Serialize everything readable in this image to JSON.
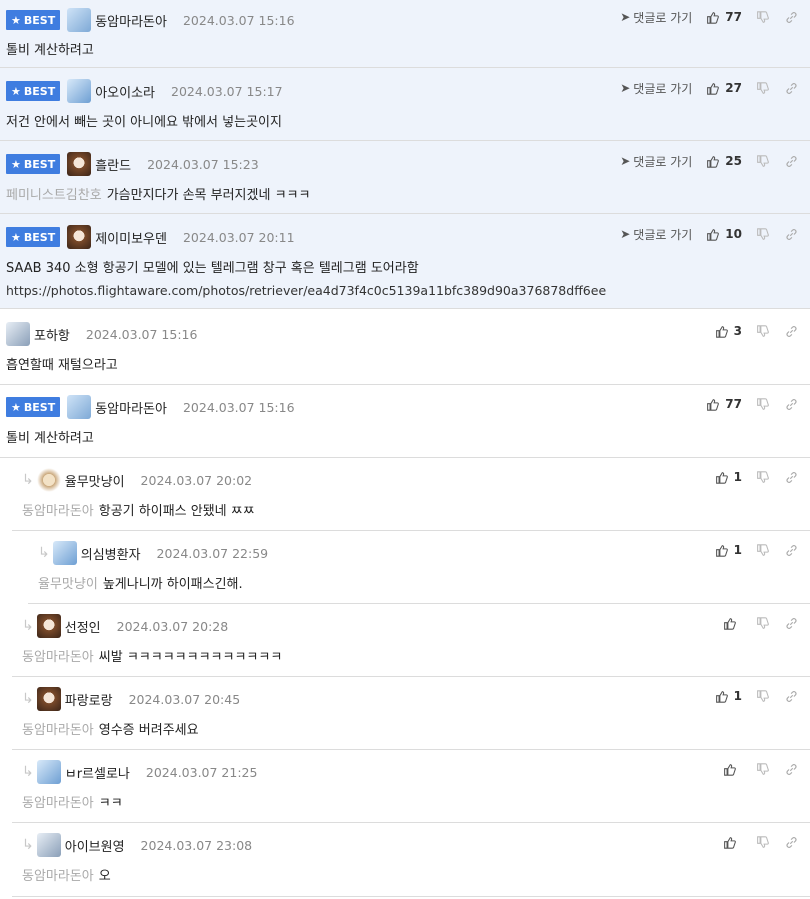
{
  "best_label": "BEST",
  "goto_label": "댓글로 가기",
  "comments": [
    {
      "nick": "동암마라돈아",
      "date": "2024.03.07 15:16",
      "text": "톨비 계산하려고",
      "likes": "77",
      "best": true,
      "goto": true,
      "avatar": "blue"
    },
    {
      "nick": "아오이소라",
      "date": "2024.03.07 15:17",
      "text": "저건 안에서 빼는 곳이 아니에요 밖에서 넣는곳이지",
      "likes": "27",
      "best": true,
      "goto": true,
      "avatar": "blue"
    },
    {
      "nick": "흘란드",
      "date": "2024.03.07 15:23",
      "mention": "페미니스트김찬호",
      "text": "가슴만지다가 손목 부러지겠네 ㅋㅋㅋ",
      "likes": "25",
      "best": true,
      "goto": true,
      "avatar": "dog"
    },
    {
      "nick": "제이미보우덴",
      "date": "2024.03.07 20:11",
      "text": "SAAB 340 소형 항공기 모델에 있는 텔레그램 창구 혹은 텔레그램 도어라함",
      "url": "https://photos.flightaware.com/photos/retriever/ea4d73f4c0c5139a11bfc389d90a376878dff6ee",
      "likes": "10",
      "best": true,
      "goto": true,
      "avatar": "dog"
    },
    {
      "nick": "포하항",
      "date": "2024.03.07 15:16",
      "text": "흡연할때 재털으라고",
      "likes": "3",
      "avatar": "cat"
    },
    {
      "nick": "동암마라돈아",
      "date": "2024.03.07 15:16",
      "text": "톨비 계산하려고",
      "likes": "77",
      "best": true,
      "avatar": "blue"
    },
    {
      "nick": "율무맛냥이",
      "date": "2024.03.07 20:02",
      "mention": "동암마라돈아",
      "text": "항공기 하이패스 안됐네 ㅉㅉ",
      "likes": "1",
      "reply": true,
      "avatar": "pup"
    },
    {
      "nick": "의심병환자",
      "date": "2024.03.07 22:59",
      "mention": "율무맛냥이",
      "text": "높게나니까 하이패스긴해.",
      "likes": "1",
      "reply": true,
      "avatar": "blue"
    },
    {
      "nick": "선정인",
      "date": "2024.03.07 20:28",
      "mention": "동암마라돈아",
      "text": "씨발 ㅋㅋㅋㅋㅋㅋㅋㅋㅋㅋㅋㅋㅋ",
      "likes": "",
      "reply": true,
      "avatar": "dog"
    },
    {
      "nick": "파랑로랑",
      "date": "2024.03.07 20:45",
      "mention": "동암마라돈아",
      "text": "영수증 버려주세요",
      "likes": "1",
      "reply": true,
      "avatar": "dog"
    },
    {
      "nick": "ㅂr르셀로나",
      "date": "2024.03.07 21:25",
      "mention": "동암마라돈아",
      "text": "ㅋㅋ",
      "likes": "",
      "reply": true,
      "avatar": "blue"
    },
    {
      "nick": "아이브원영",
      "date": "2024.03.07 23:08",
      "mention": "동암마라돈아",
      "text": "오",
      "likes": "",
      "reply": true,
      "avatar": "cat"
    }
  ]
}
